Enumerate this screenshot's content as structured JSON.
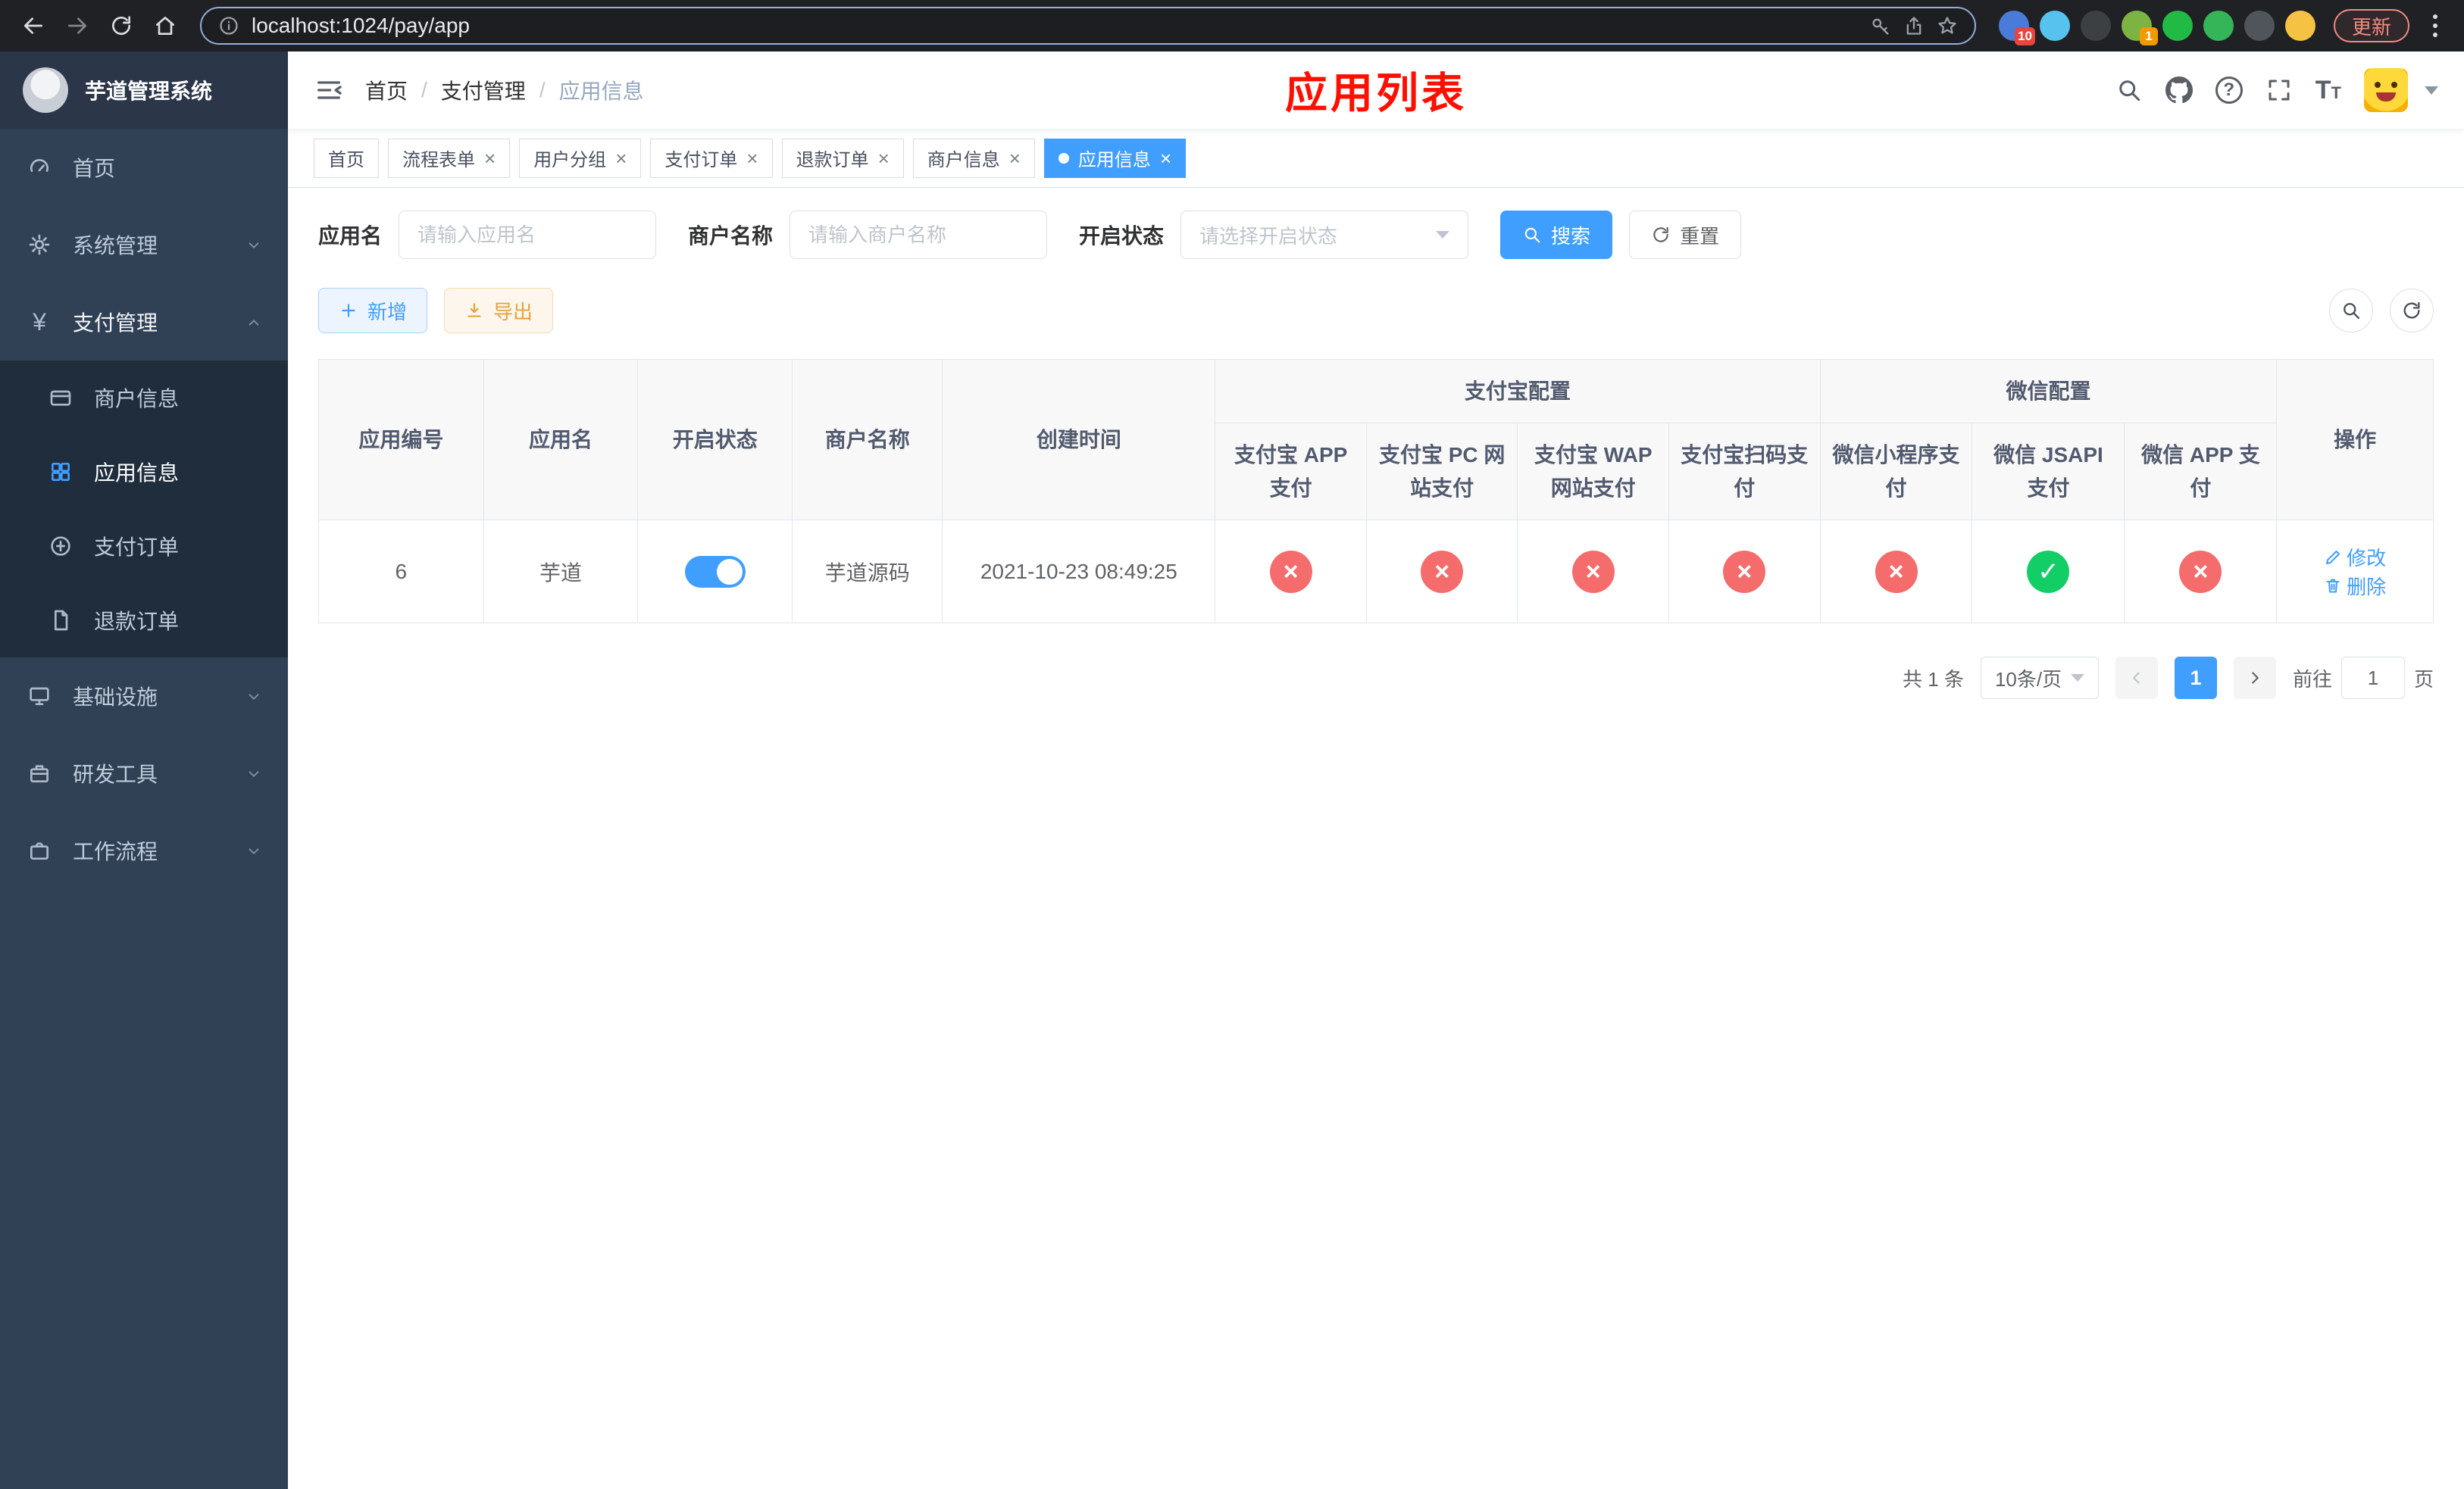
{
  "colors": {
    "accent": "#409eff",
    "danger": "#f56c6c",
    "success": "#13ce66",
    "warning": "#e6a23c",
    "annotation": "#ff0f00",
    "sidebar-bg": "#304156",
    "submenu-bg": "#1f2d3d"
  },
  "browser": {
    "url": "localhost:1024/pay/app",
    "update_label": "更新",
    "extensions": [
      {
        "name": "extension-blue",
        "color": "#4a7bd8",
        "badge": "10",
        "badge_color": "#e8453c"
      },
      {
        "name": "extension-drop",
        "color": "#57c2ee",
        "badge": ""
      },
      {
        "name": "extension-dark",
        "color": "#3c4043",
        "badge": ""
      },
      {
        "name": "extension-avatar",
        "color": "#7cb342",
        "badge": "1",
        "badge_color": "#f29900"
      },
      {
        "name": "extension-wechat-dev",
        "color": "#21ba45",
        "badge": ""
      },
      {
        "name": "extension-chat",
        "color": "#35b558",
        "badge": ""
      },
      {
        "name": "extension-pin",
        "color": "#50555c",
        "badge": ""
      },
      {
        "name": "extension-face",
        "color": "#f6c244",
        "badge": ""
      }
    ]
  },
  "sidebar": {
    "logo_title": "芋道管理系统",
    "items": [
      {
        "label": "首页"
      },
      {
        "label": "系统管理"
      },
      {
        "label": "支付管理",
        "children": [
          {
            "label": "商户信息"
          },
          {
            "label": "应用信息"
          },
          {
            "label": "支付订单"
          },
          {
            "label": "退款订单"
          }
        ]
      },
      {
        "label": "基础设施"
      },
      {
        "label": "研发工具"
      },
      {
        "label": "工作流程"
      }
    ]
  },
  "header": {
    "breadcrumb": [
      "首页",
      "支付管理",
      "应用信息"
    ],
    "annotation": "应用列表"
  },
  "tabs": [
    {
      "label": "首页",
      "closable": false,
      "active": false
    },
    {
      "label": "流程表单",
      "closable": true,
      "active": false
    },
    {
      "label": "用户分组",
      "closable": true,
      "active": false
    },
    {
      "label": "支付订单",
      "closable": true,
      "active": false
    },
    {
      "label": "退款订单",
      "closable": true,
      "active": false
    },
    {
      "label": "商户信息",
      "closable": true,
      "active": false
    },
    {
      "label": "应用信息",
      "closable": true,
      "active": true
    }
  ],
  "filters": {
    "app_name_label": "应用名",
    "app_name_placeholder": "请输入应用名",
    "merchant_label": "商户名称",
    "merchant_placeholder": "请输入商户名称",
    "status_label": "开启状态",
    "status_placeholder": "请选择开启状态",
    "search_label": "搜索",
    "reset_label": "重置"
  },
  "toolbar": {
    "add_label": "新增",
    "export_label": "导出"
  },
  "table": {
    "group_headers": {
      "alipay": "支付宝配置",
      "wechat": "微信配置"
    },
    "columns": [
      "应用编号",
      "应用名",
      "开启状态",
      "商户名称",
      "创建时间",
      "支付宝 APP 支付",
      "支付宝 PC 网站支付",
      "支付宝 WAP 网站支付",
      "支付宝扫码支付",
      "微信小程序支付",
      "微信 JSAPI 支付",
      "微信 APP 支付",
      "操作"
    ],
    "rows": [
      {
        "id": "6",
        "name": "芋道",
        "enabled": true,
        "merchant": "芋道源码",
        "created": "2021-10-23 08:49:25",
        "configs": [
          "no",
          "no",
          "no",
          "no",
          "no",
          "yes",
          "no"
        ],
        "actions": [
          "修改",
          "删除"
        ]
      }
    ]
  },
  "pagination": {
    "total": "共 1 条",
    "page_size": "10条/页",
    "pages": [
      "1"
    ],
    "goto_label": "前往",
    "goto_value": "1",
    "page_unit": "页"
  }
}
